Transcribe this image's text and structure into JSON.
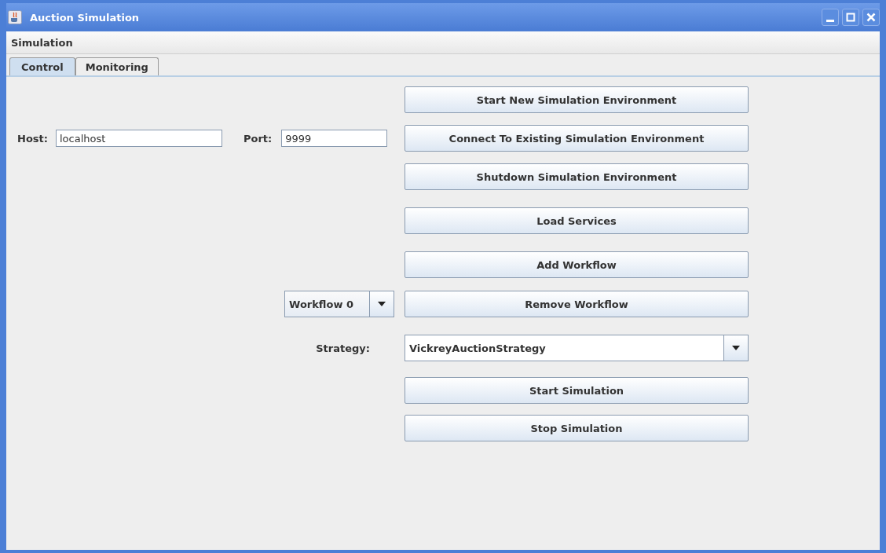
{
  "window": {
    "title": "Auction Simulation"
  },
  "menu": [
    "Simulation"
  ],
  "tabs": [
    {
      "label": "Control",
      "selected": true
    },
    {
      "label": "Monitoring",
      "selected": false
    }
  ],
  "host": {
    "label": "Host:",
    "value": "localhost"
  },
  "port": {
    "label": "Port:",
    "value": "9999"
  },
  "buttons": [
    "Start New Simulation Environment",
    "Connect To Existing Simulation Environment",
    "Shutdown Simulation Environment",
    "Load Services",
    "Add Workflow",
    "Remove Workflow"
  ],
  "workflow_select": {
    "value": "Workflow 0"
  },
  "strategy": {
    "label": "Strategy:",
    "value": "VickreyAuctionStrategy"
  },
  "sim_buttons": [
    "Start Simulation",
    "Stop Simulation"
  ]
}
